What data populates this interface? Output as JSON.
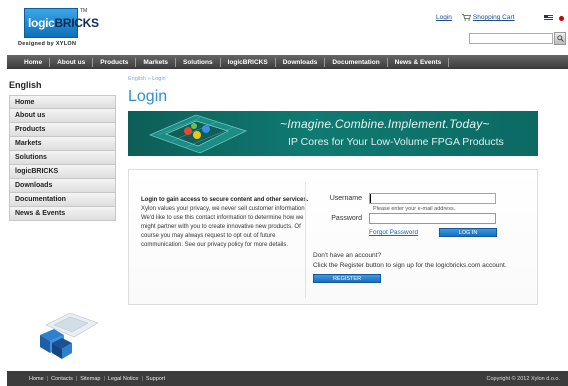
{
  "header": {
    "logo_text_a": "logic",
    "logo_text_b": "BRICKS",
    "logo_tm": "TM",
    "logo_tagline": "Designed by XYLON",
    "login_link": "Login",
    "cart_link": "Shopping Cart",
    "search_placeholder": "",
    "icons": {
      "cart": "cart-icon",
      "search": "search-icon",
      "flag": "us-flag-icon"
    }
  },
  "nav": {
    "items": [
      "Home",
      "About us",
      "Products",
      "Markets",
      "Solutions",
      "logicBRICKS",
      "Downloads",
      "Documentation",
      "News & Events"
    ]
  },
  "sidebar": {
    "language": "English",
    "items": [
      "Home",
      "About us",
      "Products",
      "Markets",
      "Solutions",
      "logicBRICKS",
      "Downloads",
      "Documentation",
      "News & Events"
    ]
  },
  "main": {
    "breadcrumb": "English » Login",
    "title": "Login",
    "banner_line1": "~Imagine.Combine.Implement.Today~",
    "banner_line2": "IP Cores for Your Low-Volume FPGA Products"
  },
  "login": {
    "info_heading": "Login to gain access to secure content and other services.",
    "info_body": "Xylon values your privacy, we never sell customer information. We'd like to use this contact information to determine how we might partner with you to create innovative new products. Of course you may always request to opt out of future communication. See our privacy policy for more details.",
    "username_label": "Username",
    "username_value": "",
    "username_hint": "Please enter your e-mail address.",
    "password_label": "Password",
    "password_value": "",
    "forgot_link": "Forgot Password",
    "login_button": "LOG IN",
    "no_account": "Don't have an account?",
    "register_text": "Click the Register button to sign up for the logicbricks.com account.",
    "register_button": "REGISTER"
  },
  "footer": {
    "links": [
      "Home",
      "Contacts",
      "Sitemap",
      "Legal Notice",
      "Support"
    ],
    "copyright": "Copyright © 2012 Xylon d.o.o."
  },
  "colors": {
    "accent": "#2f8fd0",
    "nav_bg": "#4a4a4a",
    "banner_bg": "#0f7a72",
    "button_blue": "#1a6fbe",
    "footer_bg": "#3c3c3c"
  }
}
